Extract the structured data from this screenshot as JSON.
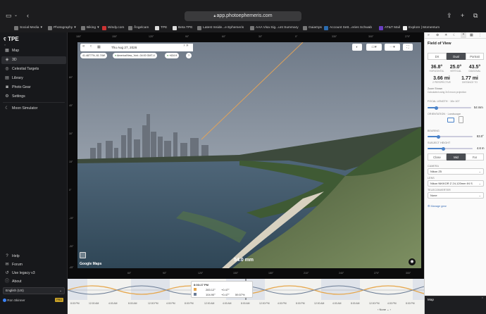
{
  "safari": {
    "url": "app.photoephemeris.com",
    "bookmarks": [
      {
        "label": "Social Media",
        "chevron": "▾"
      },
      {
        "label": "Photography",
        "chevron": "▾"
      },
      {
        "label": "Biking",
        "chevron": "▾"
      },
      {
        "label": "Windy.com",
        "chevron": ""
      },
      {
        "label": "Ångelcam",
        "chevron": ""
      },
      {
        "label": "TPE",
        "chevron": ""
      },
      {
        "label": "Beta TPE",
        "chevron": ""
      },
      {
        "label": "Latest Inside...e Ephemeris",
        "chevron": ""
      },
      {
        "label": "AAA Visa Sig...unt Summary",
        "chevron": ""
      },
      {
        "label": "GaiaGps",
        "chevron": ""
      },
      {
        "label": "Account Sett...eries Schwab",
        "chevron": ""
      },
      {
        "label": "AT&T Mail",
        "chevron": ""
      },
      {
        "label": "Explore | Momentum",
        "chevron": ""
      }
    ]
  },
  "sidebar": {
    "logo_text": "TPE",
    "items": [
      {
        "label": "Map",
        "icon": "map-icon"
      },
      {
        "label": "3D",
        "icon": "cube-icon"
      },
      {
        "label": "Celestial Targets",
        "icon": "target-icon"
      },
      {
        "label": "Library",
        "icon": "library-icon"
      },
      {
        "label": "Photo Gear",
        "icon": "camera-icon"
      },
      {
        "label": "Settings",
        "icon": "gear-icon"
      }
    ],
    "moon_simulator": "Moon Simulator",
    "bottom_items": [
      {
        "label": "Help",
        "icon": "help-icon"
      },
      {
        "label": "Forum",
        "icon": "forum-icon"
      },
      {
        "label": "Use legacy v3",
        "icon": "legacy-icon"
      },
      {
        "label": "About",
        "icon": "info-icon"
      }
    ],
    "language": "English (US)",
    "user_name": "Ron Skinner",
    "user_badge": "PRO"
  },
  "viewer": {
    "date": "Thu Aug 27, 2026",
    "coords": "41.48777N, 81.74W",
    "timezone": "America/New_York -04:00 GMT-4",
    "elevation": "+634 ft",
    "focal_label": "54.0 mm",
    "watermark": "Google Maps",
    "top_ruler": [
      "180°",
      "150°",
      "120°",
      "90°",
      "60°",
      "30°",
      "0°",
      "330°",
      "300°",
      "270°"
    ],
    "bottom_ruler": [
      "60°",
      "90°",
      "120°",
      "150°",
      "180°",
      "210°",
      "240°",
      "270°",
      "300°"
    ],
    "left_ruler": [
      "60°",
      "45°",
      "30°",
      "15°",
      "0°",
      "-15°",
      "-30°",
      "-45°"
    ]
  },
  "timeline": {
    "time": "8:03:27 PM",
    "rows": [
      {
        "az": "283.12°",
        "alt": "+0.47°",
        "extra": ""
      },
      {
        "az": "104.90°",
        "alt": "+0.47°",
        "extra": "59.57%"
      }
    ],
    "ticks": [
      "8:00 PM",
      "12:00 AM",
      "4:00 AM",
      "8:00 AM",
      "12:00 PM",
      "4:00 PM",
      "8:00 PM",
      "12:00 AM",
      "4:00 AM",
      "8:00 AM",
      "12:00 PM",
      "4:00 PM",
      "8:00 PM",
      "12:00 AM",
      "4:00 AM",
      "8:00 AM",
      "12:00 PM",
      "4:00 PM",
      "8:00 PM"
    ],
    "zoom": "None"
  },
  "panel": {
    "title": "Field of View",
    "tabs": [
      "DX",
      "Dual",
      "Portrait"
    ],
    "active_tab": "Dual",
    "stats": [
      {
        "value": "36.8°",
        "key": "HORIZONTAL"
      },
      {
        "value": "25.0°",
        "key": "VERTICAL"
      },
      {
        "value": "43.5°",
        "key": "DIAGONAL"
      }
    ],
    "stats2": [
      {
        "value": "3.66 mi",
        "key": "2 PERSPECTIVE"
      },
      {
        "value": "1.77 mi",
        "key": "DISTANCE TO"
      }
    ],
    "zoom_line": "Zoom Shown",
    "zoom_note": "Calculated using 3x3 moon projection",
    "focal_length_label": "FOCAL LENGTH · 10x 107",
    "focal_length_value": "54 mm",
    "orientation_label": "ORIENTATION · Landscape",
    "bearing_label": "BEARING",
    "bearing_value": "83.0°",
    "subject_height_label": "SUBJECT HEIGHT",
    "subject_height_value": "4.6 m",
    "range_buttons": [
      "Close",
      "Mid",
      "Far"
    ],
    "active_range": "Mid",
    "camera_label": "CAMERA",
    "camera_value": "Nikon Z5",
    "lens_label": "LENS",
    "lens_value": "Nikon NIKKOR Z 24-120mm f/4 S",
    "teleconverter_label": "TELECONVERTER",
    "teleconverter_value": "None",
    "manage_link": "Manage gear",
    "map_label": "Map"
  }
}
